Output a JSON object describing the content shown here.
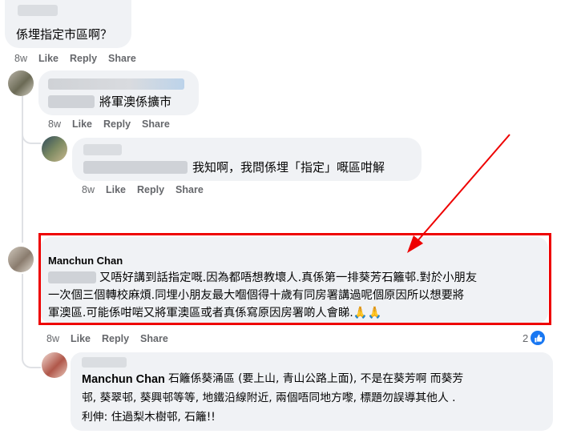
{
  "comments": [
    {
      "text": "係埋指定市區啊？",
      "time": "8w",
      "like": "Like",
      "reply": "Reply",
      "share": "Share"
    },
    {
      "text": "將軍澳係擴市",
      "time": "8w",
      "like": "Like",
      "reply": "Reply",
      "share": "Share"
    },
    {
      "text": "我知啊，我問係埋「指定」嘅區咁解",
      "time": "8w",
      "like": "Like",
      "reply": "Reply",
      "share": "Share"
    },
    {
      "author": "Manchun Chan",
      "lines": [
        "又唔好講到話指定嘅.因為都唔想教壞人.真係第一排葵芳石籬邨.對於小朋友",
        "一次個三個轉校麻煩.同埋小朋友最大嗰個得十歲有同房署講過呢個原因所以想要將",
        "軍澳區.可能係咁啱又將軍澳區或者真係寫原因房署啲人會睇."
      ],
      "emoji": "🙏🙏",
      "time": "8w",
      "like": "Like",
      "reply": "Reply",
      "share": "Share",
      "reaction_count": "2"
    },
    {
      "author": "Manchun Chan",
      "lines": [
        "石籬係葵涌區 (要上山, 青山公路上面), 不是在葵芳啊 而葵芳",
        "邨, 葵翠邨, 葵興邨等等, 地鐵沿線附近, 兩個唔同地方嚟, 標題勿誤導其他人 .",
        "利伸: 住過梨木樹邨, 石籬!!"
      ]
    }
  ],
  "colors": {
    "highlight": "#ee0000",
    "accent": "#1877f2",
    "bubble": "#f0f2f5",
    "meta": "#65676b"
  }
}
